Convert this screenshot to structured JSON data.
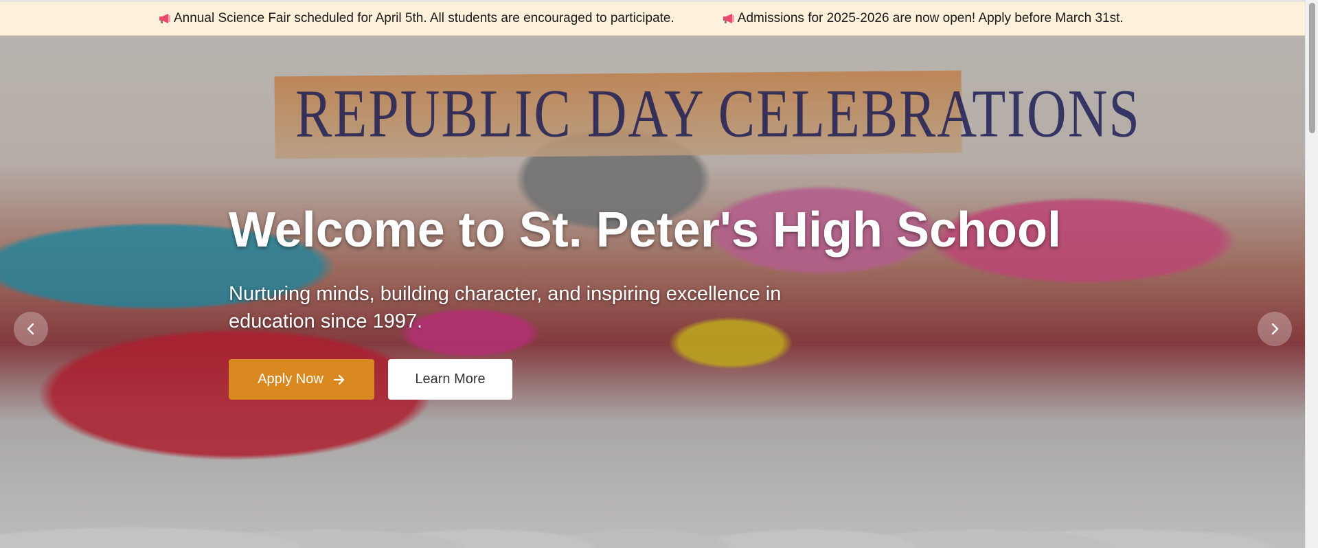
{
  "announcements": [
    {
      "icon": "megaphone-icon",
      "text": "Annual Science Fair scheduled for April 5th. All students are encouraged to participate."
    },
    {
      "icon": "megaphone-icon",
      "text": "Admissions for 2025-2026 are now open! Apply before March 31st."
    }
  ],
  "hero": {
    "banner_text": "REPUBLIC DAY CELEBRATIONS",
    "title": "Welcome to St. Peter's High School",
    "subtitle": "Nurturing minds, building character, and inspiring excellence in education since 1997.",
    "primary_button": {
      "label": "Apply Now",
      "icon": "arrow-right-icon"
    },
    "secondary_button": {
      "label": "Learn More"
    },
    "prev_icon": "chevron-left-icon",
    "next_icon": "chevron-right-icon"
  },
  "colors": {
    "announce_bg": "#fdf1dc",
    "primary": "#d9891f",
    "secondary_bg": "#ffffff"
  }
}
